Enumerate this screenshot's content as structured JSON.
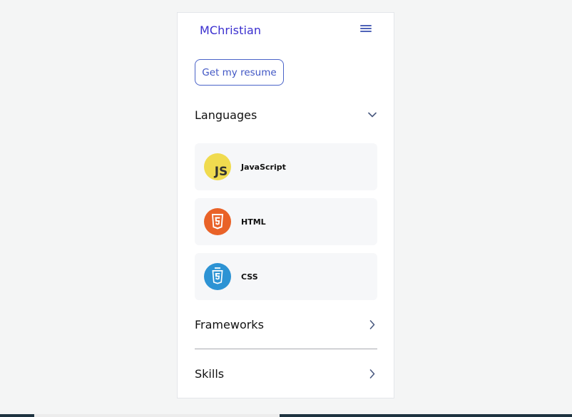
{
  "header": {
    "brand": "MChristian",
    "menu_icon": "hamburger-menu-icon"
  },
  "resume_button": {
    "label": "Get my resume"
  },
  "sections": {
    "languages": {
      "title": "Languages",
      "expanded": true,
      "chevron_icon": "chevron-down-icon",
      "items": [
        {
          "label": "JavaScript",
          "icon": "javascript-logo-icon",
          "color": "#f0db4f"
        },
        {
          "label": "HTML",
          "icon": "html5-logo-icon",
          "color": "#e96228"
        },
        {
          "label": "CSS",
          "icon": "css3-logo-icon",
          "color": "#2d93d4"
        }
      ]
    },
    "frameworks": {
      "title": "Frameworks",
      "expanded": false,
      "chevron_icon": "chevron-right-icon"
    },
    "skills": {
      "title": "Skills",
      "expanded": false,
      "chevron_icon": "chevron-right-icon"
    }
  },
  "colors": {
    "brand": "#3a2fcf",
    "accent": "#4a63c8",
    "item_bg": "#f6f7f9",
    "page_bg": "#f4f5f5"
  }
}
